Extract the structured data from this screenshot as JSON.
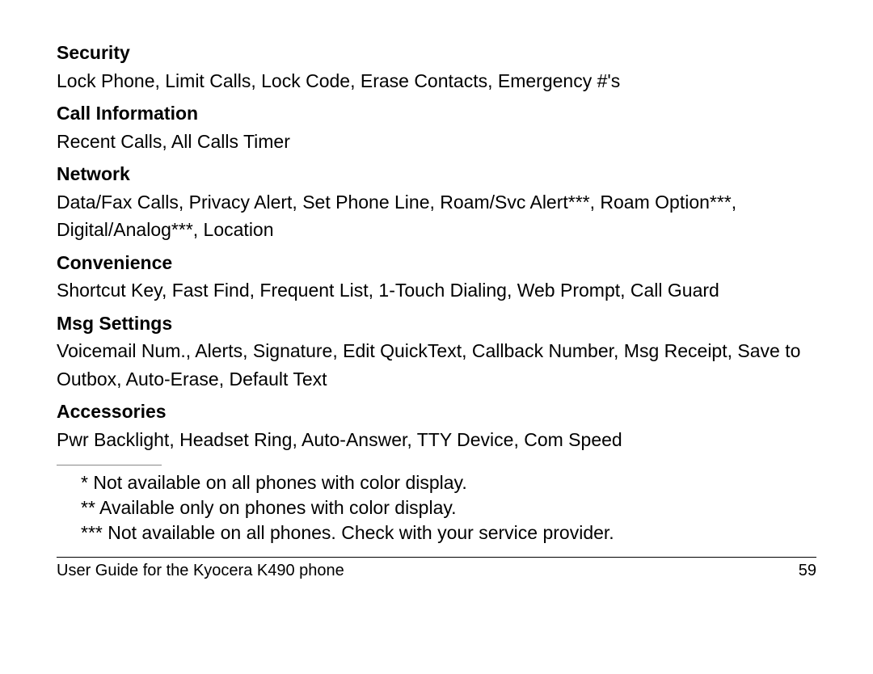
{
  "sections": {
    "security": {
      "heading": "Security",
      "body": "Lock Phone, Limit Calls, Lock Code, Erase Contacts, Emergency #'s"
    },
    "call_info": {
      "heading": "Call Information",
      "body": "Recent Calls, All Calls Timer"
    },
    "network": {
      "heading": "Network",
      "body": "Data/Fax Calls, Privacy Alert, Set Phone Line, Roam/Svc Alert***, Roam Option***, Digital/Analog***, Location"
    },
    "convenience": {
      "heading": "Convenience",
      "body": "Shortcut Key, Fast Find, Frequent List, 1-Touch Dialing, Web Prompt, Call Guard"
    },
    "msg_settings": {
      "heading": "Msg Settings",
      "body": "Voicemail Num., Alerts, Signature, Edit QuickText, Callback Number, Msg Receipt, Save to Outbox, Auto-Erase, Default Text"
    },
    "accessories": {
      "heading": "Accessories",
      "body": "Pwr Backlight, Headset Ring, Auto-Answer, TTY Device, Com Speed"
    }
  },
  "footnotes": {
    "f1": "* Not available on all phones with color display.",
    "f2": "** Available only on phones with color display.",
    "f3": "*** Not available on all phones. Check with your service provider."
  },
  "footer": {
    "left": "User Guide for the Kyocera K490 phone",
    "right": "59"
  }
}
